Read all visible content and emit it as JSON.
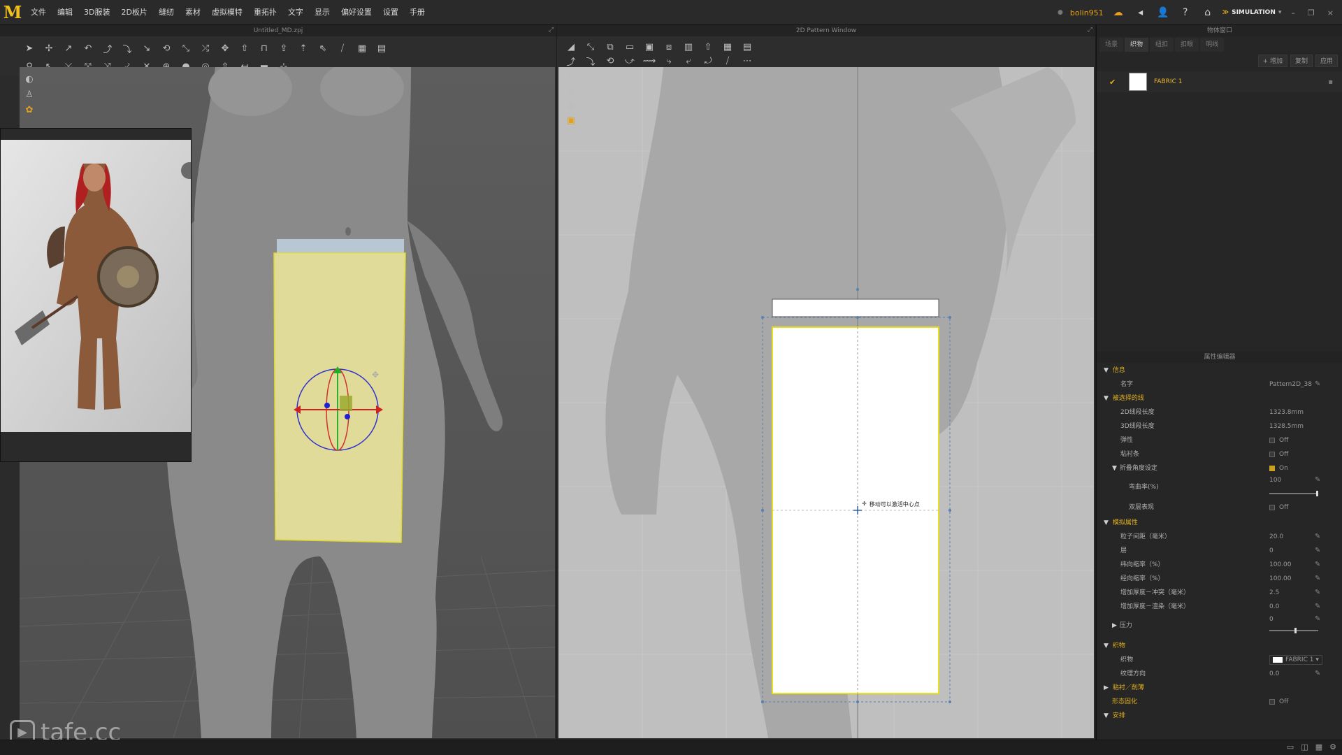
{
  "app": {
    "logo_letter": "M",
    "menu": [
      "文件",
      "编辑",
      "3D服装",
      "2D板片",
      "缝纫",
      "素材",
      "虚拟模特",
      "重拓扑",
      "文字",
      "显示",
      "偏好设置",
      "设置",
      "手册"
    ],
    "username": "bolin951",
    "mode": "SIMULATION"
  },
  "panel3d": {
    "title": "Untitled_MD.zpj"
  },
  "panel2d": {
    "title": "2D Pattern Window",
    "tooltip": "移动可以激活中心点"
  },
  "object_browser": {
    "title": "物体窗口",
    "tabs": [
      "场景",
      "织物",
      "纽扣",
      "扣眼",
      "明线"
    ],
    "active_tab": "织物",
    "buttons": [
      "+ 增加",
      "复制",
      "应用"
    ],
    "fabric": {
      "name": "FABRIC 1",
      "swatch_color": "#ffffff"
    }
  },
  "property_editor": {
    "title": "属性编辑器",
    "sections": {
      "info": "信息",
      "selected_line": "被选择的线",
      "simulation": "模拟属性",
      "fabric": "织物",
      "bond": "粘衬／削薄",
      "freeze_pattern": "形态固化",
      "arrangement": "安排"
    },
    "rows": {
      "name_label": "名字",
      "name_value": "Pattern2D_38",
      "len2d_label": "2D线段长度",
      "len2d_value": "1323.8mm",
      "len3d_label": "3D线段长度",
      "len3d_value": "1328.5mm",
      "elastic_label": "弹性",
      "elastic_value": "Off",
      "tape_label": "粘衬条",
      "tape_value": "Off",
      "fold_label": "折叠角度设定",
      "fold_value": "On",
      "curve_label": "弯曲率(%)",
      "curve_value": "100",
      "layer_label": "双层表现",
      "layer_value": "Off",
      "particle_label": "粒子间距（毫米）",
      "particle_value": "20.0",
      "layer2_label": "层",
      "layer2_value": "0",
      "shrink_weft_label": "纬向缩率（%）",
      "shrink_weft_value": "100.00",
      "shrink_warp_label": "经向缩率（%）",
      "shrink_warp_value": "100.00",
      "thick_col_label": "增加厚度－冲突（毫米）",
      "thick_col_value": "2.5",
      "thick_ren_label": "增加厚度－渲染（毫米）",
      "thick_ren_value": "0.0",
      "pressure_label": "压力",
      "pressure_value": "0",
      "fabric_label": "织物",
      "fabric_value": "FABRIC 1",
      "grain_label": "纹理方向",
      "grain_value": "0.0",
      "freeze_value": "Off"
    }
  },
  "watermark": "tafe.cc"
}
